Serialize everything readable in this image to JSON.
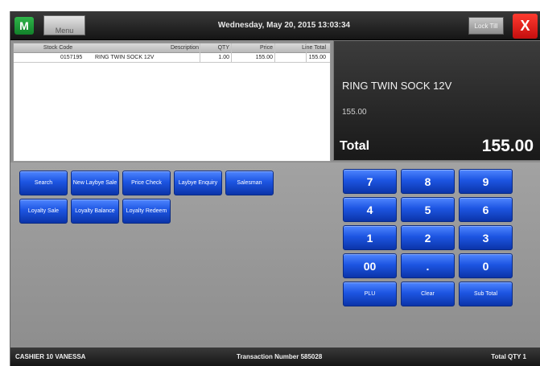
{
  "header": {
    "logo": "M",
    "menu_label": "Menu",
    "datetime": "Wednesday, May 20, 2015 13:03:34",
    "lock_label": "Lock Till",
    "close_label": "X"
  },
  "table": {
    "columns": [
      "Stock Code",
      "Description",
      "QTY",
      "Price",
      "Line Total"
    ],
    "rows": [
      {
        "stock_code": "0157195",
        "description": "RING TWIN SOCK 12V",
        "qty": "1.00",
        "price": "155.00",
        "line_total": "155.00"
      }
    ]
  },
  "display": {
    "item_name": "RING TWIN SOCK 12V",
    "item_price": "155.00",
    "total_label": "Total",
    "total_value": "155.00"
  },
  "function_buttons": [
    "Search",
    "New Laybye Sale",
    "Price Check",
    "Laybye Enquiry",
    "Salesman",
    "Loyalty Sale",
    "Loyalty Balance",
    "Loyalty Redeem"
  ],
  "keypad": [
    "7",
    "8",
    "9",
    "4",
    "5",
    "6",
    "1",
    "2",
    "3",
    "00",
    ".",
    "0",
    "PLU",
    "Clear",
    "Sub Total"
  ],
  "status": {
    "cashier": "CASHIER 10 VANESSA",
    "transaction": "Transaction Number  585028",
    "total_qty": "Total QTY  1"
  },
  "colors": {
    "button_blue": "#1d55e2",
    "close_red": "#e0161a",
    "logo_green": "#1d9b38",
    "bar_dark": "#1e1e1e"
  }
}
